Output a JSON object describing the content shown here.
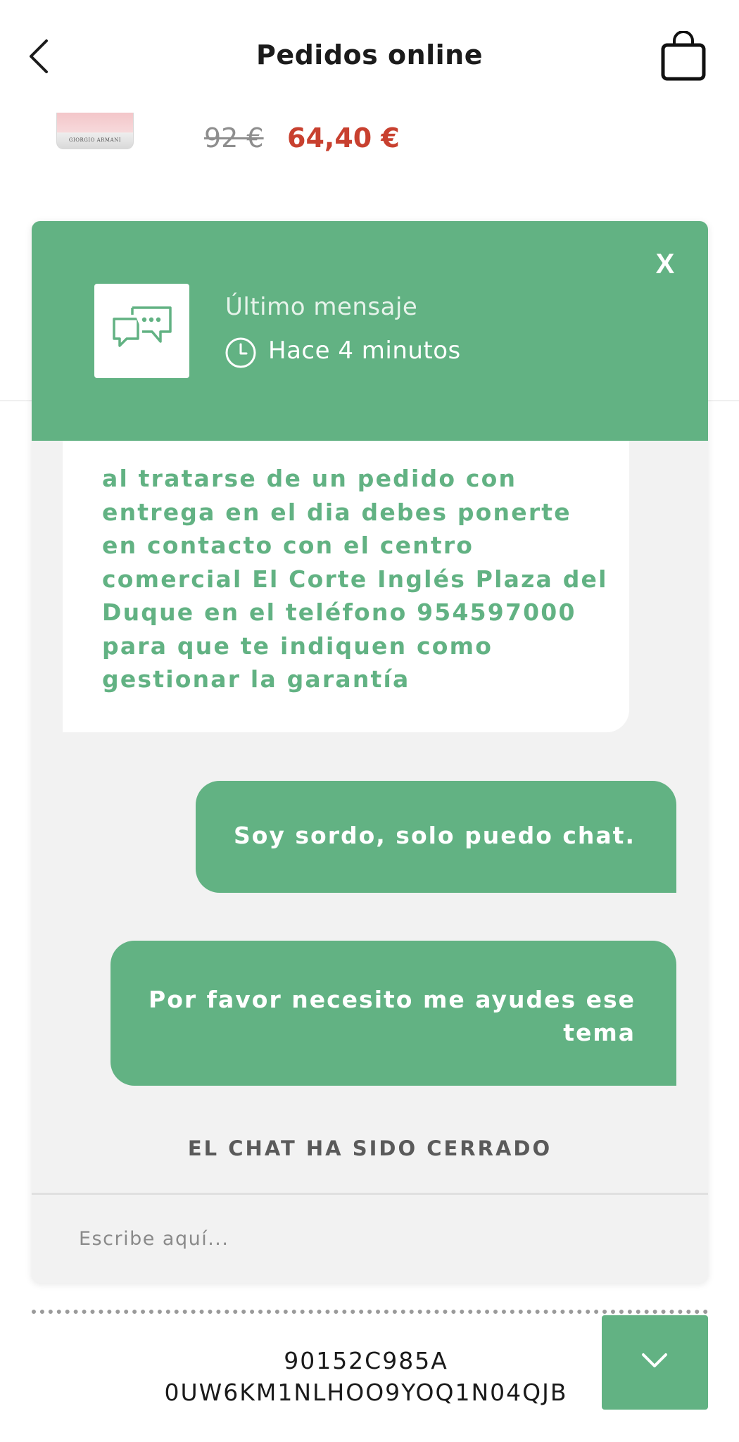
{
  "header": {
    "title": "Pedidos online",
    "back_icon": "chevron-left-icon",
    "cart_icon": "shopping-bag-icon"
  },
  "product": {
    "brand": "GIORGIO ARMANI",
    "old_price": "92 €",
    "new_price": "64,40 €"
  },
  "chat": {
    "last_message_label": "Último mensaje",
    "last_message_time": "Hace 4 minutos",
    "close_label": "X",
    "messages": [
      {
        "from": "agent",
        "text": "al tratarse de un pedido con entrega en el dia debes ponerte en contacto con el centro comercial El Corte Inglés Plaza del Duque en el teléfono 954597000 para que te indiquen como gestionar la garantía"
      },
      {
        "from": "user",
        "text": "Soy sordo, solo puedo chat."
      },
      {
        "from": "user",
        "text": "Por favor necesito me ayudes ese tema"
      }
    ],
    "closed_notice": "EL CHAT HA SIDO CERRADO",
    "input_placeholder": "Escribe aquí..."
  },
  "order": {
    "code_line1": "90152C985A",
    "code_line2": "0UW6KM1NLHOO9YOQ1N04QJB"
  },
  "colors": {
    "accent_green": "#62b283",
    "price_red": "#c8402f",
    "panel_bg": "#f2f2f2"
  }
}
